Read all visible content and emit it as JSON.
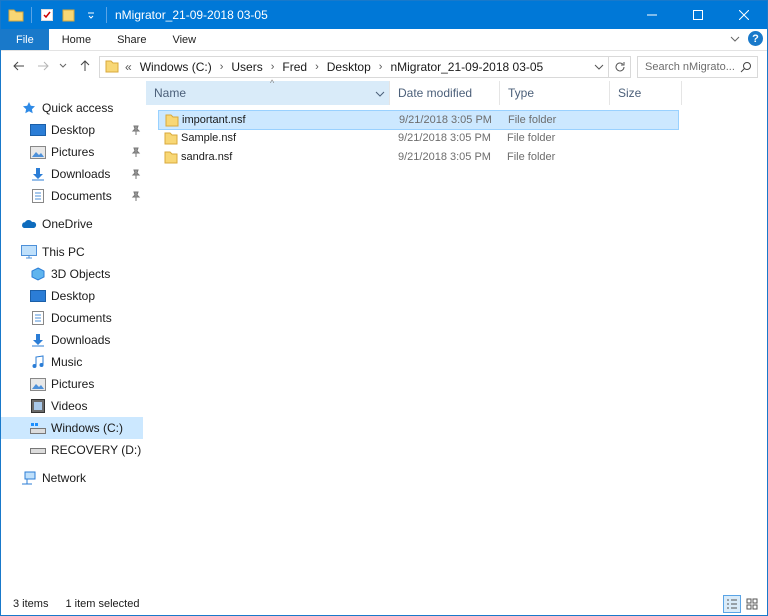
{
  "window": {
    "title": "nMigrator_21-09-2018 03-05"
  },
  "ribbon": {
    "tabs": [
      "File",
      "Home",
      "Share",
      "View"
    ]
  },
  "address": {
    "overflow": "«",
    "crumbs": [
      "Windows (C:)",
      "Users",
      "Fred",
      "Desktop",
      "nMigrator_21-09-2018 03-05"
    ]
  },
  "search": {
    "placeholder": "Search nMigrato..."
  },
  "nav": {
    "quick_access": "Quick access",
    "quick_items": [
      "Desktop",
      "Pictures",
      "Downloads",
      "Documents"
    ],
    "onedrive": "OneDrive",
    "this_pc": "This PC",
    "pc_items": [
      "3D Objects",
      "Desktop",
      "Documents",
      "Downloads",
      "Music",
      "Pictures",
      "Videos",
      "Windows (C:)",
      "RECOVERY (D:)"
    ],
    "network": "Network",
    "selected": "Windows (C:)"
  },
  "columns": {
    "name": "Name",
    "date": "Date modified",
    "type": "Type",
    "size": "Size"
  },
  "files": [
    {
      "name": "important.nsf",
      "date": "9/21/2018 3:05 PM",
      "type": "File folder",
      "selected": true
    },
    {
      "name": "Sample.nsf",
      "date": "9/21/2018 3:05 PM",
      "type": "File folder",
      "selected": false
    },
    {
      "name": "sandra.nsf",
      "date": "9/21/2018 3:05 PM",
      "type": "File folder",
      "selected": false
    }
  ],
  "status": {
    "count": "3 items",
    "selection": "1 item selected"
  },
  "colors": {
    "titlebar": "#0078d7",
    "file_tab": "#1979ca",
    "selection": "#cce8ff",
    "folder": "#f8d775"
  },
  "icons": [
    "folder-icon",
    "pin-icon",
    "desktop-icon",
    "pictures-icon",
    "downloads-icon",
    "documents-icon",
    "onedrive-icon",
    "this-pc-icon",
    "objects-3d-icon",
    "music-icon",
    "videos-icon",
    "drive-icon",
    "network-icon",
    "search-icon",
    "refresh-icon",
    "help-icon"
  ]
}
